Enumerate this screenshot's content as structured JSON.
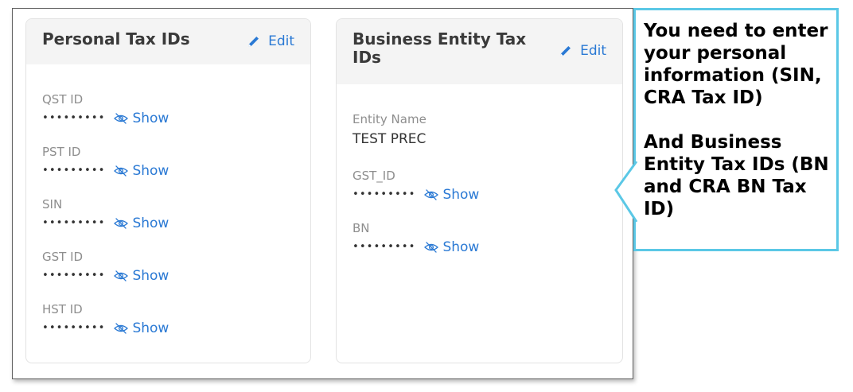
{
  "personal": {
    "title": "Personal Tax IDs",
    "edit_label": "Edit",
    "fields": [
      {
        "label": "QST ID",
        "masked": "•••••••••",
        "show_label": "Show"
      },
      {
        "label": "PST ID",
        "masked": "•••••••••",
        "show_label": "Show"
      },
      {
        "label": "SIN",
        "masked": "•••••••••",
        "show_label": "Show"
      },
      {
        "label": "GST ID",
        "masked": "•••••••••",
        "show_label": "Show"
      },
      {
        "label": "HST ID",
        "masked": "•••••••••",
        "show_label": "Show"
      }
    ]
  },
  "business": {
    "title": "Business Entity Tax IDs",
    "edit_label": "Edit",
    "entity_name_label": "Entity Name",
    "entity_name_value": "TEST PREC",
    "fields": [
      {
        "label": "GST_ID",
        "masked": "•••••••••",
        "show_label": "Show"
      },
      {
        "label": "BN",
        "masked": "•••••••••",
        "show_label": "Show"
      }
    ]
  },
  "callout": {
    "paragraph1": "You need to enter your personal information (SIN, CRA Tax ID)",
    "paragraph2": "And Business Entity Tax IDs (BN and CRA BN Tax ID)"
  },
  "colors": {
    "accent": "#2a79d4",
    "callout_border": "#5bc8e6",
    "header_bg": "#f4f4f4"
  },
  "icons": {
    "edit": "pencil-icon",
    "show": "eye-slash-icon"
  }
}
